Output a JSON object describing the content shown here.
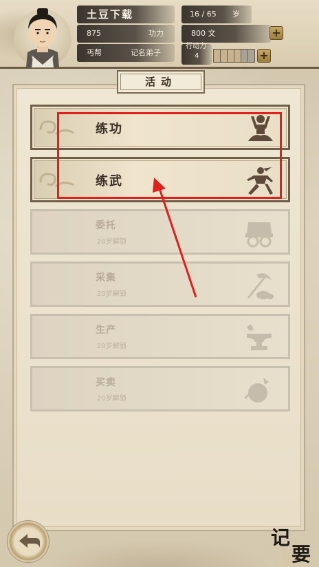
{
  "player": {
    "name": "土豆下载",
    "age": "16 / 65",
    "age_unit": "岁",
    "kungfu_value": "875",
    "kungfu_label": "功力",
    "money": "800 文",
    "sect": "丐帮",
    "rank": "记名弟子",
    "action_label": "行动力",
    "action_value": "4",
    "action_points_filled": 4,
    "action_points_total": 6
  },
  "panel": {
    "title": "活动"
  },
  "activities": [
    {
      "label": "练功",
      "sub": "",
      "locked": false,
      "icon": "meditation-icon"
    },
    {
      "label": "练武",
      "sub": "",
      "locked": false,
      "icon": "martial-stance-icon"
    },
    {
      "label": "委托",
      "sub": "20岁解锁",
      "locked": true,
      "icon": "cart-icon"
    },
    {
      "label": "采集",
      "sub": "20岁解锁",
      "locked": true,
      "icon": "pickaxe-icon"
    },
    {
      "label": "生产",
      "sub": "20岁解锁",
      "locked": true,
      "icon": "anvil-icon"
    },
    {
      "label": "买卖",
      "sub": "20岁解锁",
      "locked": true,
      "icon": "money-bag-icon"
    }
  ],
  "footer": {
    "notes_char1": "记",
    "notes_char2": "要"
  },
  "colors": {
    "highlight": "#e0201c",
    "frame": "#6e5d48",
    "panel": "#efe6d3"
  }
}
